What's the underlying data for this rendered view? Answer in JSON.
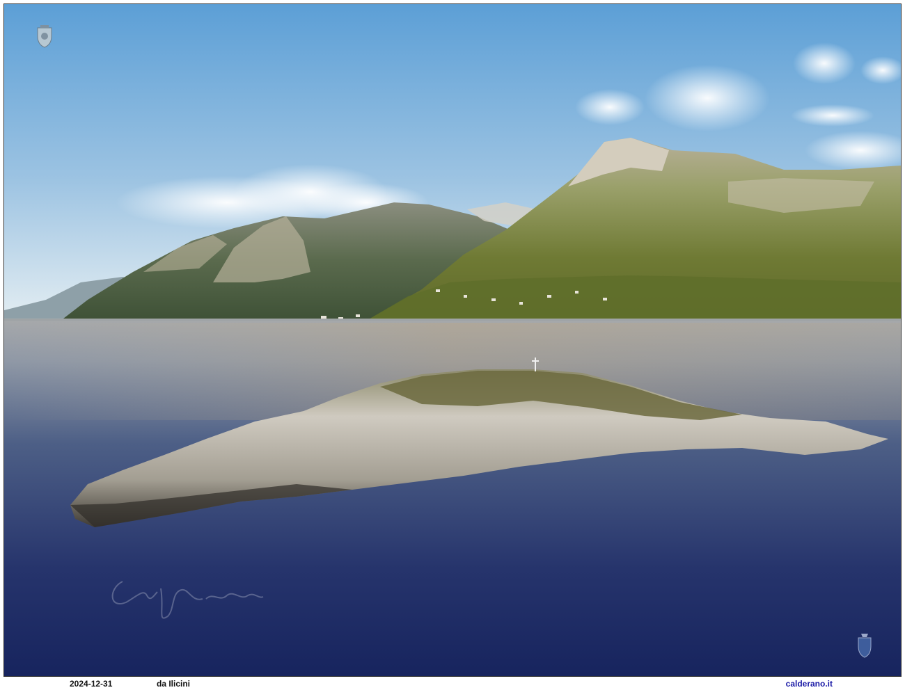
{
  "photo": {
    "subject": "Rocky islet in a calm bay with mountains and coastline",
    "colors": {
      "sky_top": "#5c9fd6",
      "sky_horizon": "#e3edf2",
      "sea_far": "#8f98a6",
      "sea_near": "#17245e",
      "rock_light": "#cfcac0",
      "rock_dark": "#3e3a34",
      "hill_green": "#7f8a3b",
      "mountain_shadow": "#4d5b3e"
    }
  },
  "watermarks": {
    "logo_top": "crest-logo",
    "logo_bottom": "crest-logo",
    "signature": "handwritten-signature"
  },
  "footer": {
    "date": "2024-12-31",
    "caption": "da Ilicini",
    "site": "calderano.it"
  }
}
